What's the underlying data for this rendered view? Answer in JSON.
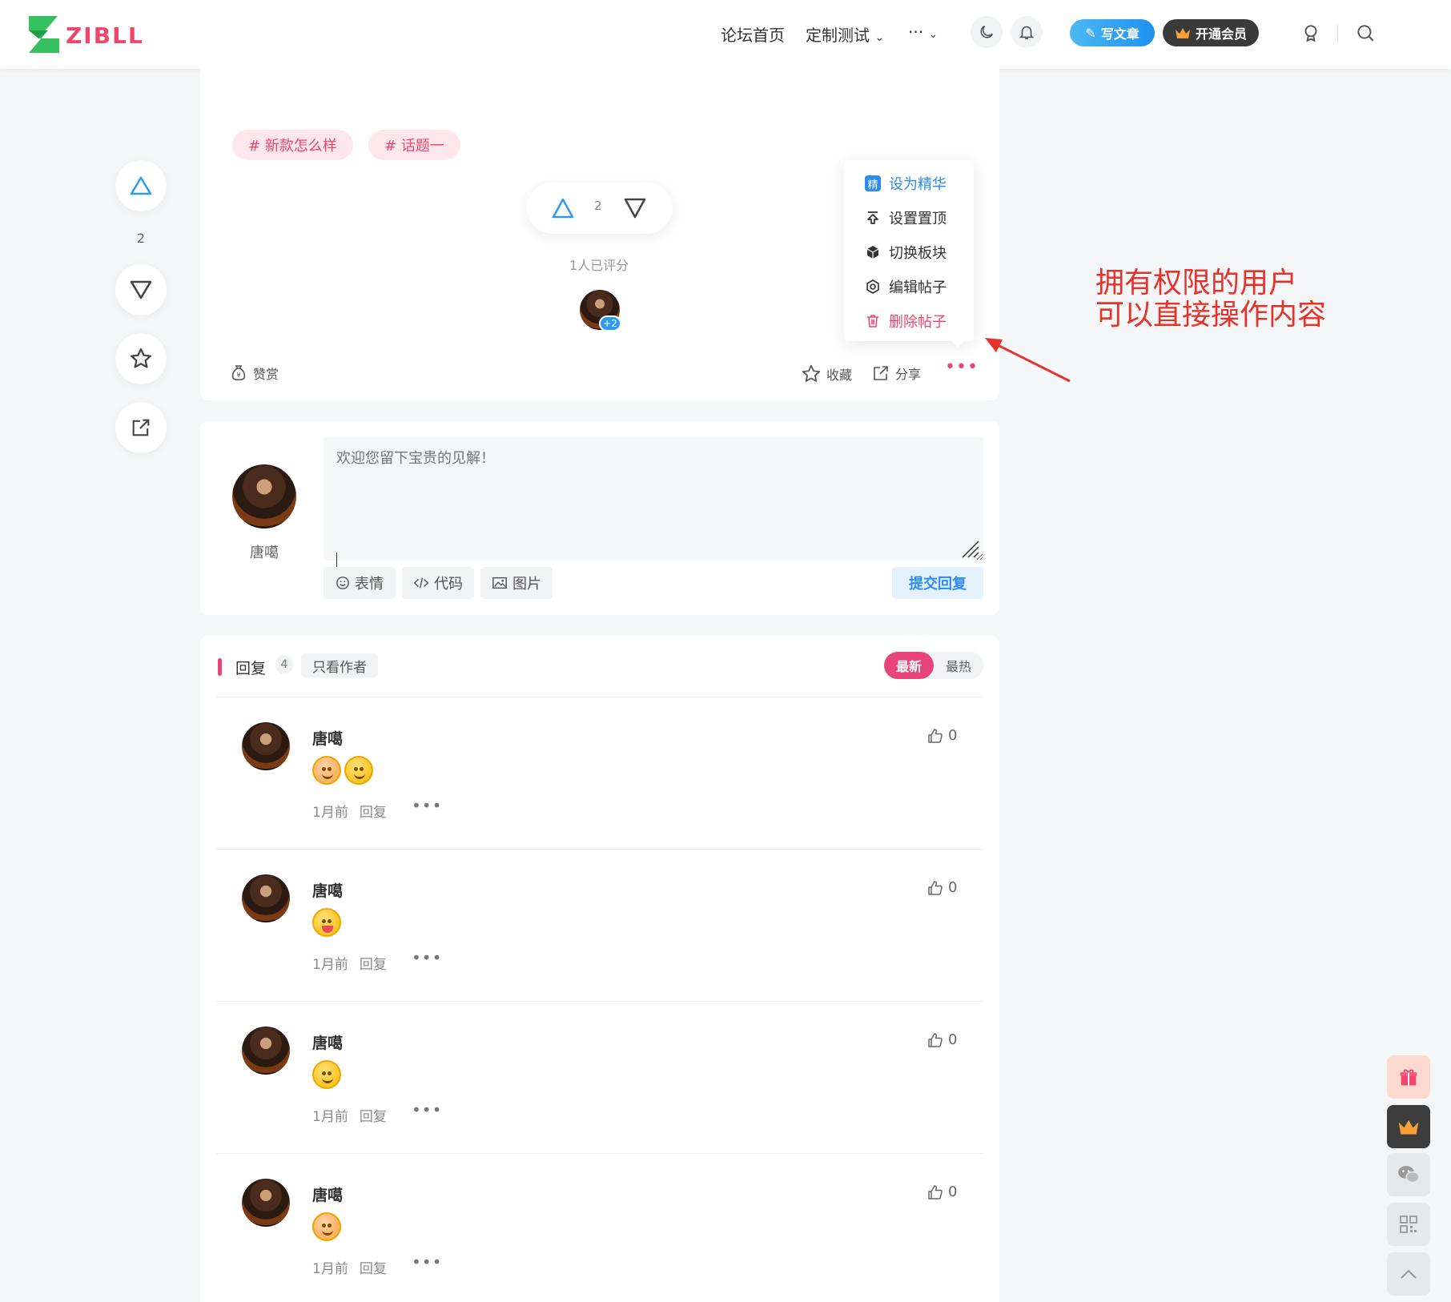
{
  "header": {
    "nav": [
      "论坛首页",
      "定制测试",
      "···"
    ],
    "write_label": "写文章",
    "vip_label": "开通会员"
  },
  "post": {
    "tags": [
      "# 新款怎么样",
      "# 话题一"
    ],
    "vote_count": "2",
    "rated_text": "1人已评分",
    "plus_count": "+2",
    "reward_label": "赞赏",
    "favorite_label": "收藏",
    "share_label": "分享"
  },
  "dropdown": {
    "items": [
      {
        "label": "设为精华",
        "icon": "essence-icon",
        "badge": "精",
        "color": "#2d8cf0"
      },
      {
        "label": "设置置顶",
        "icon": "pin-top-icon",
        "color": "#333333"
      },
      {
        "label": "切换板块",
        "icon": "cube-icon",
        "color": "#333333"
      },
      {
        "label": "编辑帖子",
        "icon": "gear-icon",
        "color": "#333333"
      },
      {
        "label": "删除帖子",
        "icon": "trash-icon",
        "color": "#f0466b"
      }
    ]
  },
  "annotation": {
    "line1": "拥有权限的用户",
    "line2": "可以直接操作内容"
  },
  "rail": {
    "vote_count": "2"
  },
  "comment": {
    "user_name": "唐噶",
    "placeholder": "欢迎您留下宝贵的见解！",
    "emoji_label": "表情",
    "code_label": "代码",
    "image_label": "图片",
    "submit_label": "提交回复"
  },
  "replies": {
    "title": "回复",
    "count": "4",
    "author_only_label": "只看作者",
    "sort_new": "最新",
    "sort_hot": "最热",
    "items": [
      {
        "name": "唐噶",
        "time": "1月前",
        "reply": "回复",
        "likes": "0",
        "emojis": [
          "blush",
          "smile"
        ]
      },
      {
        "name": "唐噶",
        "time": "1月前",
        "reply": "回复",
        "likes": "0",
        "emojis": [
          "tongue"
        ]
      },
      {
        "name": "唐噶",
        "time": "1月前",
        "reply": "回复",
        "likes": "0",
        "emojis": [
          "smile"
        ]
      },
      {
        "name": "唐噶",
        "time": "1月前",
        "reply": "回复",
        "likes": "0",
        "emojis": [
          "blush"
        ]
      }
    ]
  },
  "colors": {
    "accent_pink": "#e8447a",
    "accent_blue": "#2d8cf0",
    "annotation_red": "#e5322a"
  }
}
